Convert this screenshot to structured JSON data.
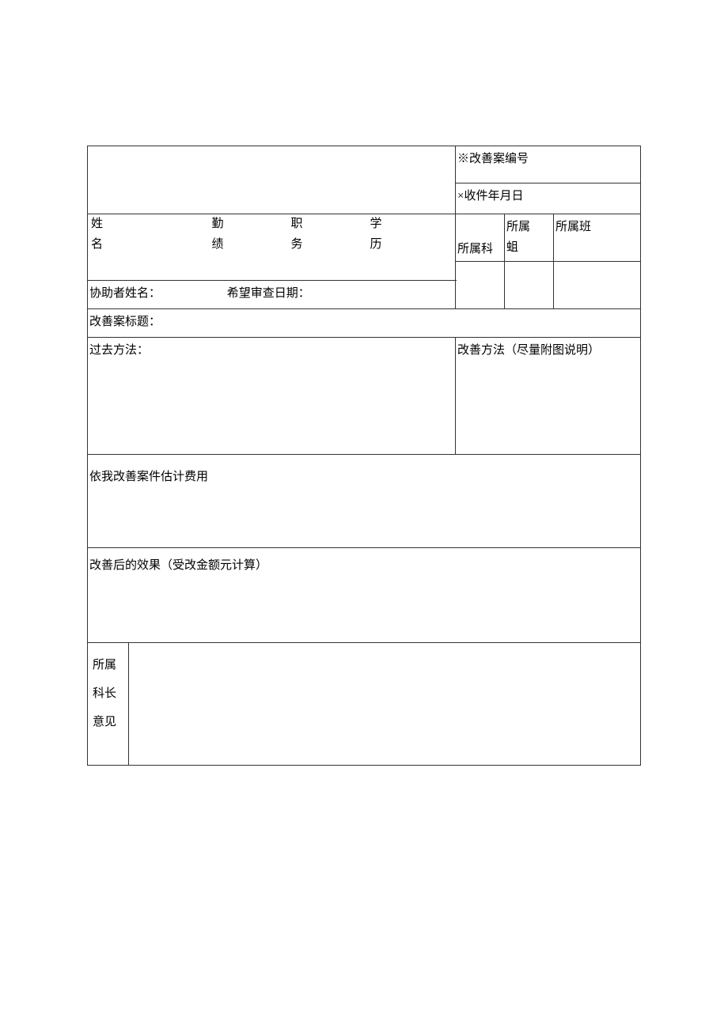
{
  "header": {
    "case_no_label": "※改善案编号",
    "recv_date_label": "×收件年月日"
  },
  "row1": {
    "name_label_1": "姓",
    "name_label_2": "名",
    "perf_label_1": "勤",
    "perf_label_2": "绩",
    "duty_label_1": "职",
    "duty_label_2": "务",
    "edu_label_1": "学",
    "edu_label_2": "历",
    "dept_section_label": "所属科",
    "dept_group_label_1": "所属",
    "dept_group_label_2": "蛆",
    "dept_class_label": "所属班"
  },
  "row2": {
    "helper_label": "协助者姓名：",
    "review_date_label": "希望审查日期："
  },
  "row3": {
    "title_label": "改善案标题："
  },
  "row4": {
    "past_method_label": "过去方法：",
    "improve_method_label": "改善方法（尽量附图说明）"
  },
  "row5": {
    "cost_label": "依我改善案件估计费用"
  },
  "row6": {
    "effect_label": "改善后的效果（受改金额元计算）"
  },
  "row7": {
    "opinion_label_1": "所属",
    "opinion_label_2": "科长",
    "opinion_label_3": "意见"
  }
}
